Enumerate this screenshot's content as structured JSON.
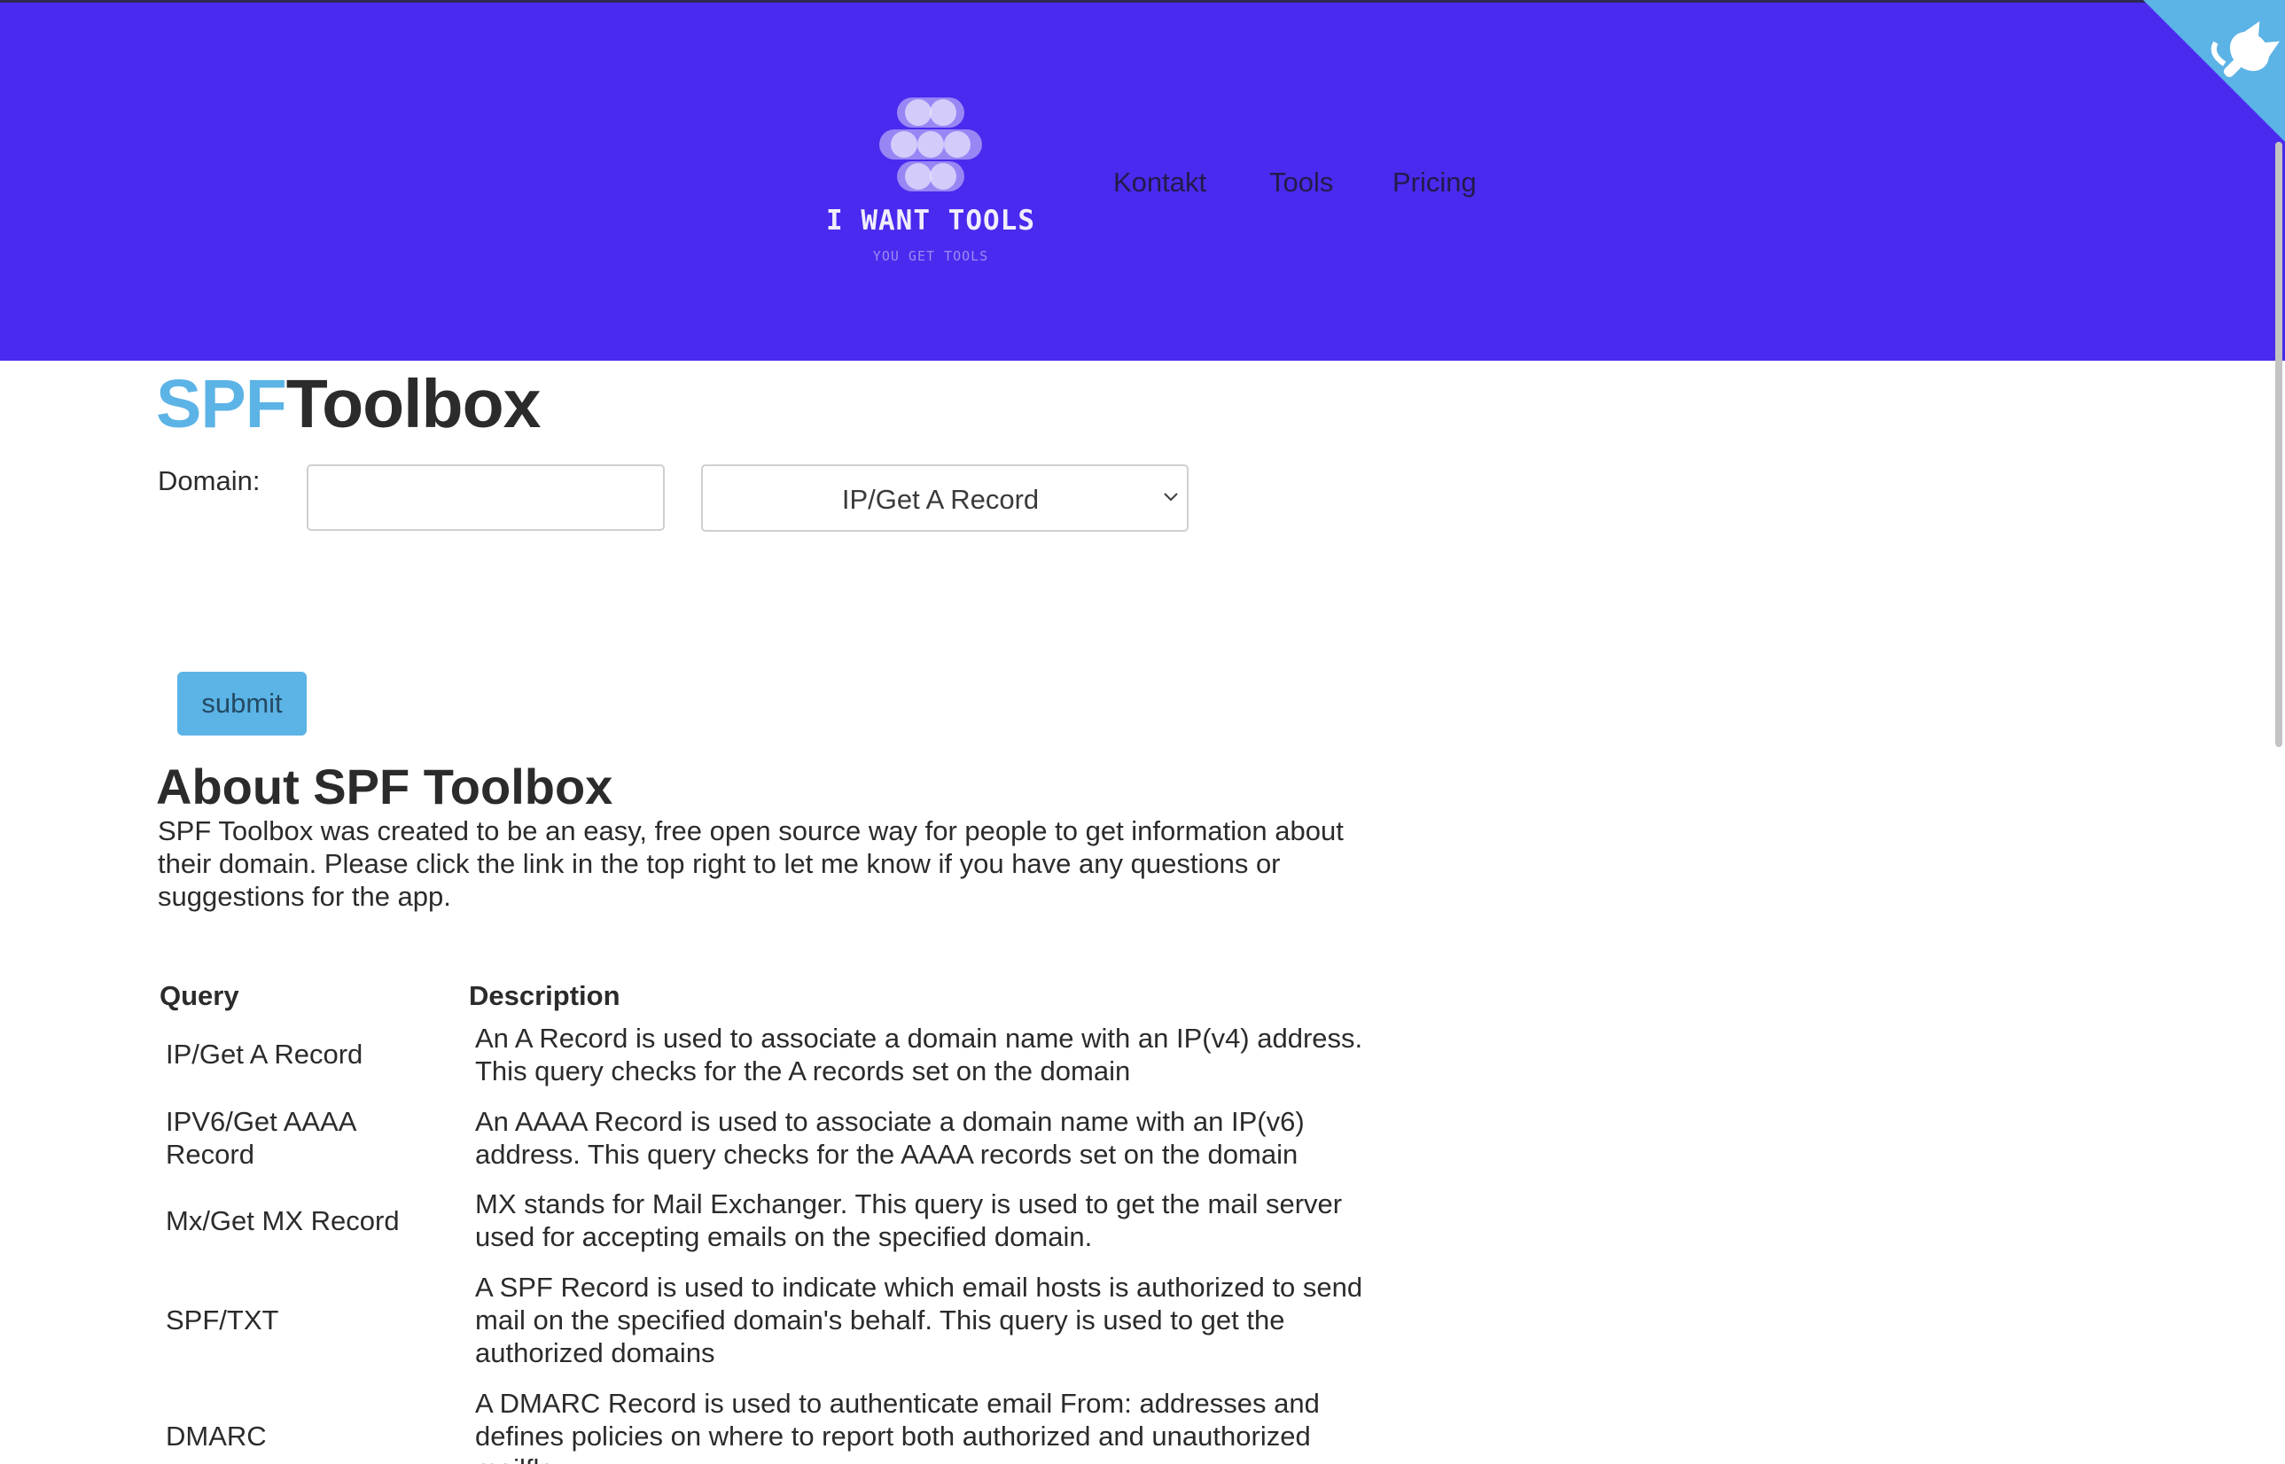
{
  "brand": {
    "name": "I WANT TOOLS",
    "tagline": "YOU GET TOOLS"
  },
  "nav": [
    "Kontakt",
    "Tools",
    "Pricing"
  ],
  "title": {
    "part1": "SPF",
    "part2": "Toolbox"
  },
  "form": {
    "domain_label": "Domain:",
    "domain_value": "",
    "selected_query": "IP/Get A Record",
    "submit_label": "submit"
  },
  "about": {
    "heading": "About SPF Toolbox",
    "lines": [
      "SPF Toolbox was created to be an easy, free open source way for people to get information about",
      "their domain. Please click the link in the top right to let me know if you have any questions or",
      "suggestions for the app."
    ]
  },
  "table": {
    "headers": [
      "Query",
      "Description"
    ],
    "rows": [
      {
        "query": [
          "IP/Get A Record"
        ],
        "description": [
          "An A Record is used to associate a domain name with an IP(v4) address.",
          "This query checks for the A records set on the domain"
        ]
      },
      {
        "query": [
          "IPV6/Get AAAA",
          "Record"
        ],
        "description": [
          "An AAAA Record is used to associate a domain name with an IP(v6)",
          "address. This query checks for the AAAA records set on the domain"
        ]
      },
      {
        "query": [
          "Mx/Get MX Record"
        ],
        "description": [
          "MX stands for Mail Exchanger. This query is used to get the mail server",
          "used for accepting emails on the specified domain."
        ]
      },
      {
        "query": [
          "SPF/TXT"
        ],
        "description": [
          "A SPF Record is used to indicate which email hosts is authorized to send",
          "mail on the specified domain's behalf. This query is used to get the",
          "authorized domains"
        ]
      },
      {
        "query": [
          "DMARC"
        ],
        "description": [
          "A DMARC Record is used to authenticate email From: addresses and",
          "defines policies on where to report both authorized and unauthorized",
          "mailflow"
        ]
      }
    ]
  },
  "colors": {
    "header_bg": "#4a2aee",
    "accent": "#5cb3e6",
    "text": "#2b2b2b"
  },
  "icons": [
    "github-corner-icon",
    "select-chevron-icon",
    "logo-mark-icon"
  ]
}
